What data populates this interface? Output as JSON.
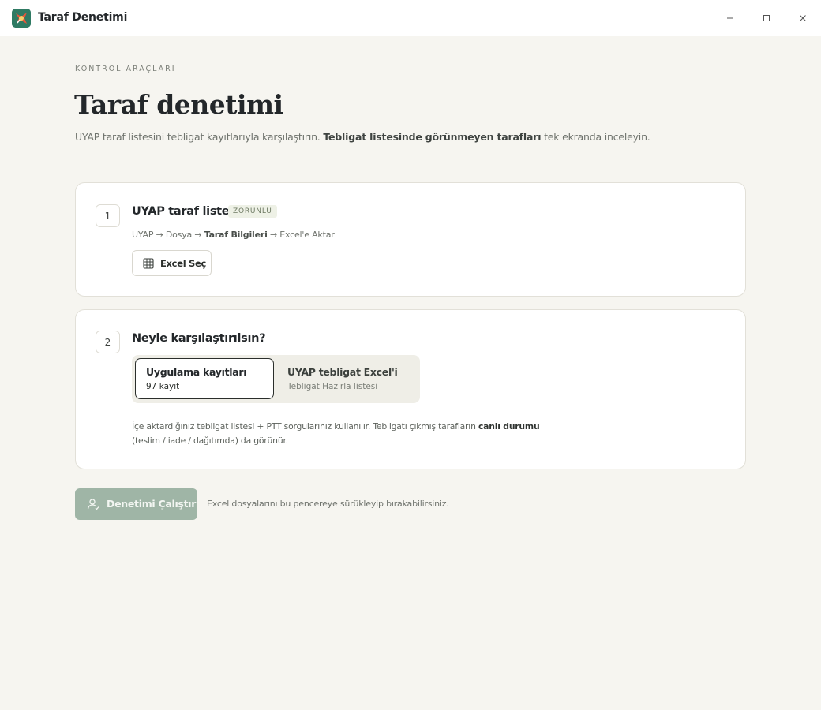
{
  "window": {
    "title": "Taraf Denetimi",
    "controls": {
      "minimize": "—",
      "maximize": "☐",
      "close": "✕"
    }
  },
  "header": {
    "eyebrow": "KONTROL ARAÇLARI",
    "title": "Taraf denetimi",
    "subtitle_pre": "UYAP taraf listesini tebligat kayıtlarıyla karşılaştırın. ",
    "subtitle_bold": "Tebligat listesinde görünmeyen tarafları",
    "subtitle_post": " tek ekranda inceleyin."
  },
  "step1": {
    "number": "1",
    "title": "UYAP taraf listesi",
    "badge": "ZORUNLU",
    "path_pre": "UYAP → Dosya → ",
    "path_bold": "Taraf Bilgileri",
    "path_post": " → Excel'e Aktar",
    "button_label": "Excel Seç",
    "button_icon": "table-grid-icon"
  },
  "step2": {
    "number": "2",
    "title": "Neyle karşılaştırılsın?",
    "options": [
      {
        "title": "Uygulama kayıtları",
        "subtitle": "97 kayıt",
        "selected": true
      },
      {
        "title": "UYAP tebligat Excel'i",
        "subtitle": "Tebligat Hazırla listesi",
        "selected": false
      }
    ],
    "desc_pre": "İçe aktardığınız tebligat listesi + PTT sorgularınız kullanılır. Tebligatı çıkmış tarafların ",
    "desc_bold": "canlı durumu",
    "desc_post": "(teslim / iade / dağıtımda) da görünür."
  },
  "actions": {
    "run_label": "Denetimi Çalıştır",
    "run_icon": "user-check-icon",
    "drop_hint": "Excel dosyalarını bu pencereye sürükleyip bırakabilirsiniz."
  },
  "colors": {
    "background": "#f6f5f0",
    "accent": "#2f7a63",
    "run_button_disabled": "#9fb5a6",
    "badge_bg": "#eef1e6"
  }
}
